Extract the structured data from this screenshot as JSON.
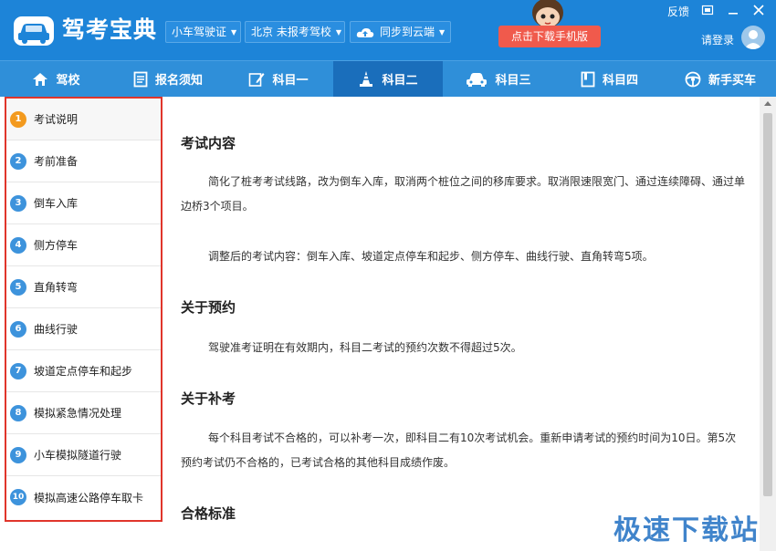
{
  "app": {
    "title": "驾考宝典",
    "license_type": "小车驾驶证",
    "location": "北京 未报考驾校",
    "sync": "同步到云端",
    "download": "点击下载手机版",
    "feedback": "反馈",
    "login": "请登录"
  },
  "nav": [
    {
      "label": "驾校",
      "icon": "home-icon"
    },
    {
      "label": "报名须知",
      "icon": "document-icon"
    },
    {
      "label": "科目一",
      "icon": "pencil-icon"
    },
    {
      "label": "科目二",
      "icon": "cone-icon"
    },
    {
      "label": "科目三",
      "icon": "car-icon"
    },
    {
      "label": "科目四",
      "icon": "book-icon"
    },
    {
      "label": "新手买车",
      "icon": "steering-wheel-icon"
    }
  ],
  "nav_active": "科目二",
  "sidebar": [
    {
      "num": "1",
      "label": "考试说明"
    },
    {
      "num": "2",
      "label": "考前准备"
    },
    {
      "num": "3",
      "label": "倒车入库"
    },
    {
      "num": "4",
      "label": "侧方停车"
    },
    {
      "num": "5",
      "label": "直角转弯"
    },
    {
      "num": "6",
      "label": "曲线行驶"
    },
    {
      "num": "7",
      "label": "坡道定点停车和起步"
    },
    {
      "num": "8",
      "label": "模拟紧急情况处理"
    },
    {
      "num": "9",
      "label": "小车模拟隧道行驶"
    },
    {
      "num": "10",
      "label": "模拟高速公路停车取卡"
    }
  ],
  "content": {
    "s1_title": "考试内容",
    "s1_p1": "简化了桩考考试线路，改为倒车入库，取消两个桩位之间的移库要求。取消限速限宽门、通过连续障碍、通过单边桥3个项目。",
    "s1_p2": "调整后的考试内容：倒车入库、坡道定点停车和起步、侧方停车、曲线行驶、直角转弯5项。",
    "s2_title": "关于预约",
    "s2_p1": "驾驶准考证明在有效期内，科目二考试的预约次数不得超过5次。",
    "s3_title": "关于补考",
    "s3_p1": "每个科目考试不合格的，可以补考一次，即科目二有10次考试机会。重新申请考试的预约时间为10日。第5次预约考试仍不合格的，已考试合格的其他科目成绩作废。",
    "s4_title": "合格标准"
  },
  "watermark": "极速下载站",
  "colors": {
    "header": "#1d84d8",
    "nav": "#2f8fd9",
    "nav_active": "#1a6ebb",
    "download": "#f05a4c",
    "sidebar_border": "#e0352b",
    "badge": "#3d93dc",
    "badge_active": "#f39a1e"
  }
}
